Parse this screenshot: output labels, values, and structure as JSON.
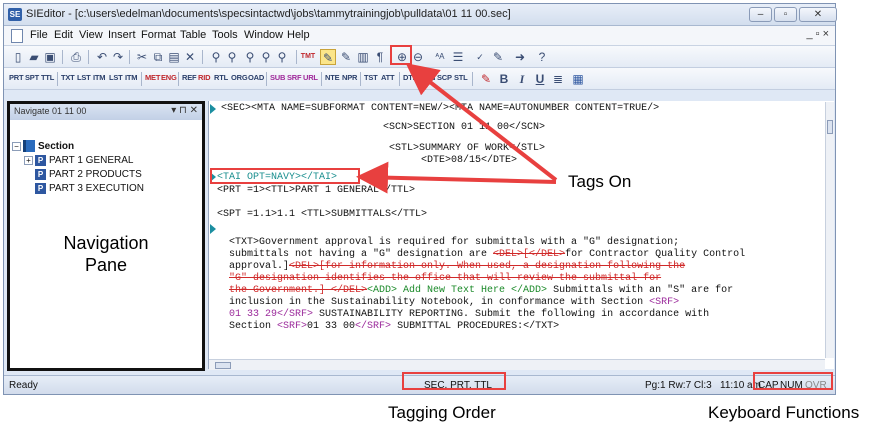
{
  "window": {
    "app_icon": "SE",
    "title": "SIEditor - [c:\\users\\edelman\\documents\\specsintactwd\\jobs\\tammytrainingjob\\pulldata\\01 11 00.sec]",
    "minimize_icon": "minimize-icon",
    "maximize_icon": "maximize-icon",
    "close_icon": "close-icon"
  },
  "menu": {
    "items": [
      "File",
      "Edit",
      "View",
      "Insert",
      "Format",
      "Table",
      "Tools",
      "Window",
      "Help"
    ],
    "mdi_controls": "_ ▫ ×"
  },
  "toolbar_tags": [
    "PRT",
    "SPT",
    "TTL",
    "TXT",
    "LST",
    "ITM",
    "LST",
    "ITM",
    "MET",
    "ENG",
    "REF",
    "RID",
    "RTL",
    "ORG",
    "OAD",
    "SUB",
    "SRF",
    "URL",
    "NTE",
    "NPR",
    "TST",
    "ATT",
    "DTE",
    "SCN",
    "SCP",
    "STL"
  ],
  "tags_on_button": "TMT",
  "nav": {
    "header": "Navigate 01 11 00",
    "header_controls": "▾ ⊓ ✕",
    "root": "Section",
    "items": [
      {
        "label": "PART 1  GENERAL",
        "expander": "+"
      },
      {
        "label": "PART 2  PRODUCTS",
        "expander": ""
      },
      {
        "label": "PART 3  EXECUTION",
        "expander": ""
      }
    ],
    "pane_label_line1": "Navigation",
    "pane_label_line2": "Pane"
  },
  "editor": {
    "line1": "<SEC><MTA NAME=SUBFORMAT CONTENT=NEW/><MTA NAME=AUTONUMBER CONTENT=TRUE/>",
    "line2": "<SCN>SECTION 01 11 00</SCN>",
    "line3": "<STL>SUMMARY OF WORK</STL>",
    "line4": "<DTE>08/15</DTE>",
    "line5": "<TAI OPT=NAVY></TAI>",
    "line6": "<PRT =1><TTL>PART 1    GENERAL</TTL>",
    "line7": "<SPT =1.1>1.1    <TTL>SUBMITTALS</TTL>",
    "line8": "<TXT>Government approval is required for submittals with a \"G\" designation;",
    "line9a": "submittals not having a \"G\" designation are ",
    "line9b": "<DEL>[</DEL>",
    "line9c": "for Contractor Quality Control",
    "line10a": "approval.]",
    "line10b": "<DEL>[for information only.  When used, a designation following the",
    "line11": "\"G\" designation identifies the office that will review the submittal for",
    "line12a": "the Government.] </DEL>",
    "line12b": "<ADD> Add New Text Here </ADD>",
    "line12c": " Submittals with an \"S\" are for",
    "line13": "inclusion in the Sustainability Notebook, in conformance with Section ",
    "line13b": "<SRF>",
    "line14a": "01 33 29",
    "line14b": "</SRF>",
    "line14c": " SUSTAINABILITY REPORTING.  Submit the following in accordance with",
    "line15a": "Section ",
    "line15b": "<SRF>",
    "line15c": "01 33 00",
    "line15d": "</SRF>",
    "line15e": " SUBMITTAL PROCEDURES:</TXT>"
  },
  "status": {
    "ready": "Ready",
    "tagging_order": "SEC, PRT, TTL",
    "position": "Pg:1 Rw:7 Cl:3",
    "time": "11:10 am",
    "caps": "CAP",
    "num": "NUM",
    "ovr": "OVR"
  },
  "annotations": {
    "tags_on": "Tags On",
    "tagging_order": "Tagging Order",
    "keyboard_functions": "Keyboard Functions"
  },
  "colors": {
    "highlight": "#e8403f",
    "arrow": "#e8403f",
    "tag_magenta": "#9b2a9b",
    "tag_green": "#1c8a2a",
    "tag_red": "#d02a2a",
    "tag_cyan": "#1a8f8f"
  }
}
